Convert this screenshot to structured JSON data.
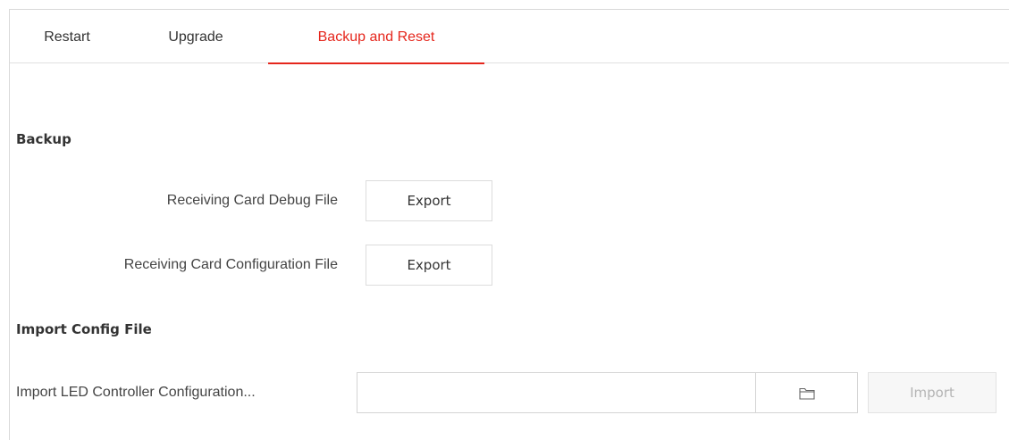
{
  "tabs": [
    {
      "label": "Restart",
      "active": false
    },
    {
      "label": "Upgrade",
      "active": false
    },
    {
      "label": "Backup and Reset",
      "active": true
    }
  ],
  "backup": {
    "title": "Backup",
    "rows": [
      {
        "label": "Receiving Card Debug File",
        "button": "Export"
      },
      {
        "label": "Receiving Card Configuration File",
        "button": "Export"
      }
    ]
  },
  "import_config": {
    "title": "Import Config File",
    "label": "Import LED Controller Configuration...",
    "file_value": "",
    "browse_icon": "folder-icon",
    "import_button": "Import",
    "import_enabled": false
  },
  "colors": {
    "accent": "#e5261c",
    "border": "#d9d9d9",
    "disabled_text": "#b4b4b4"
  }
}
